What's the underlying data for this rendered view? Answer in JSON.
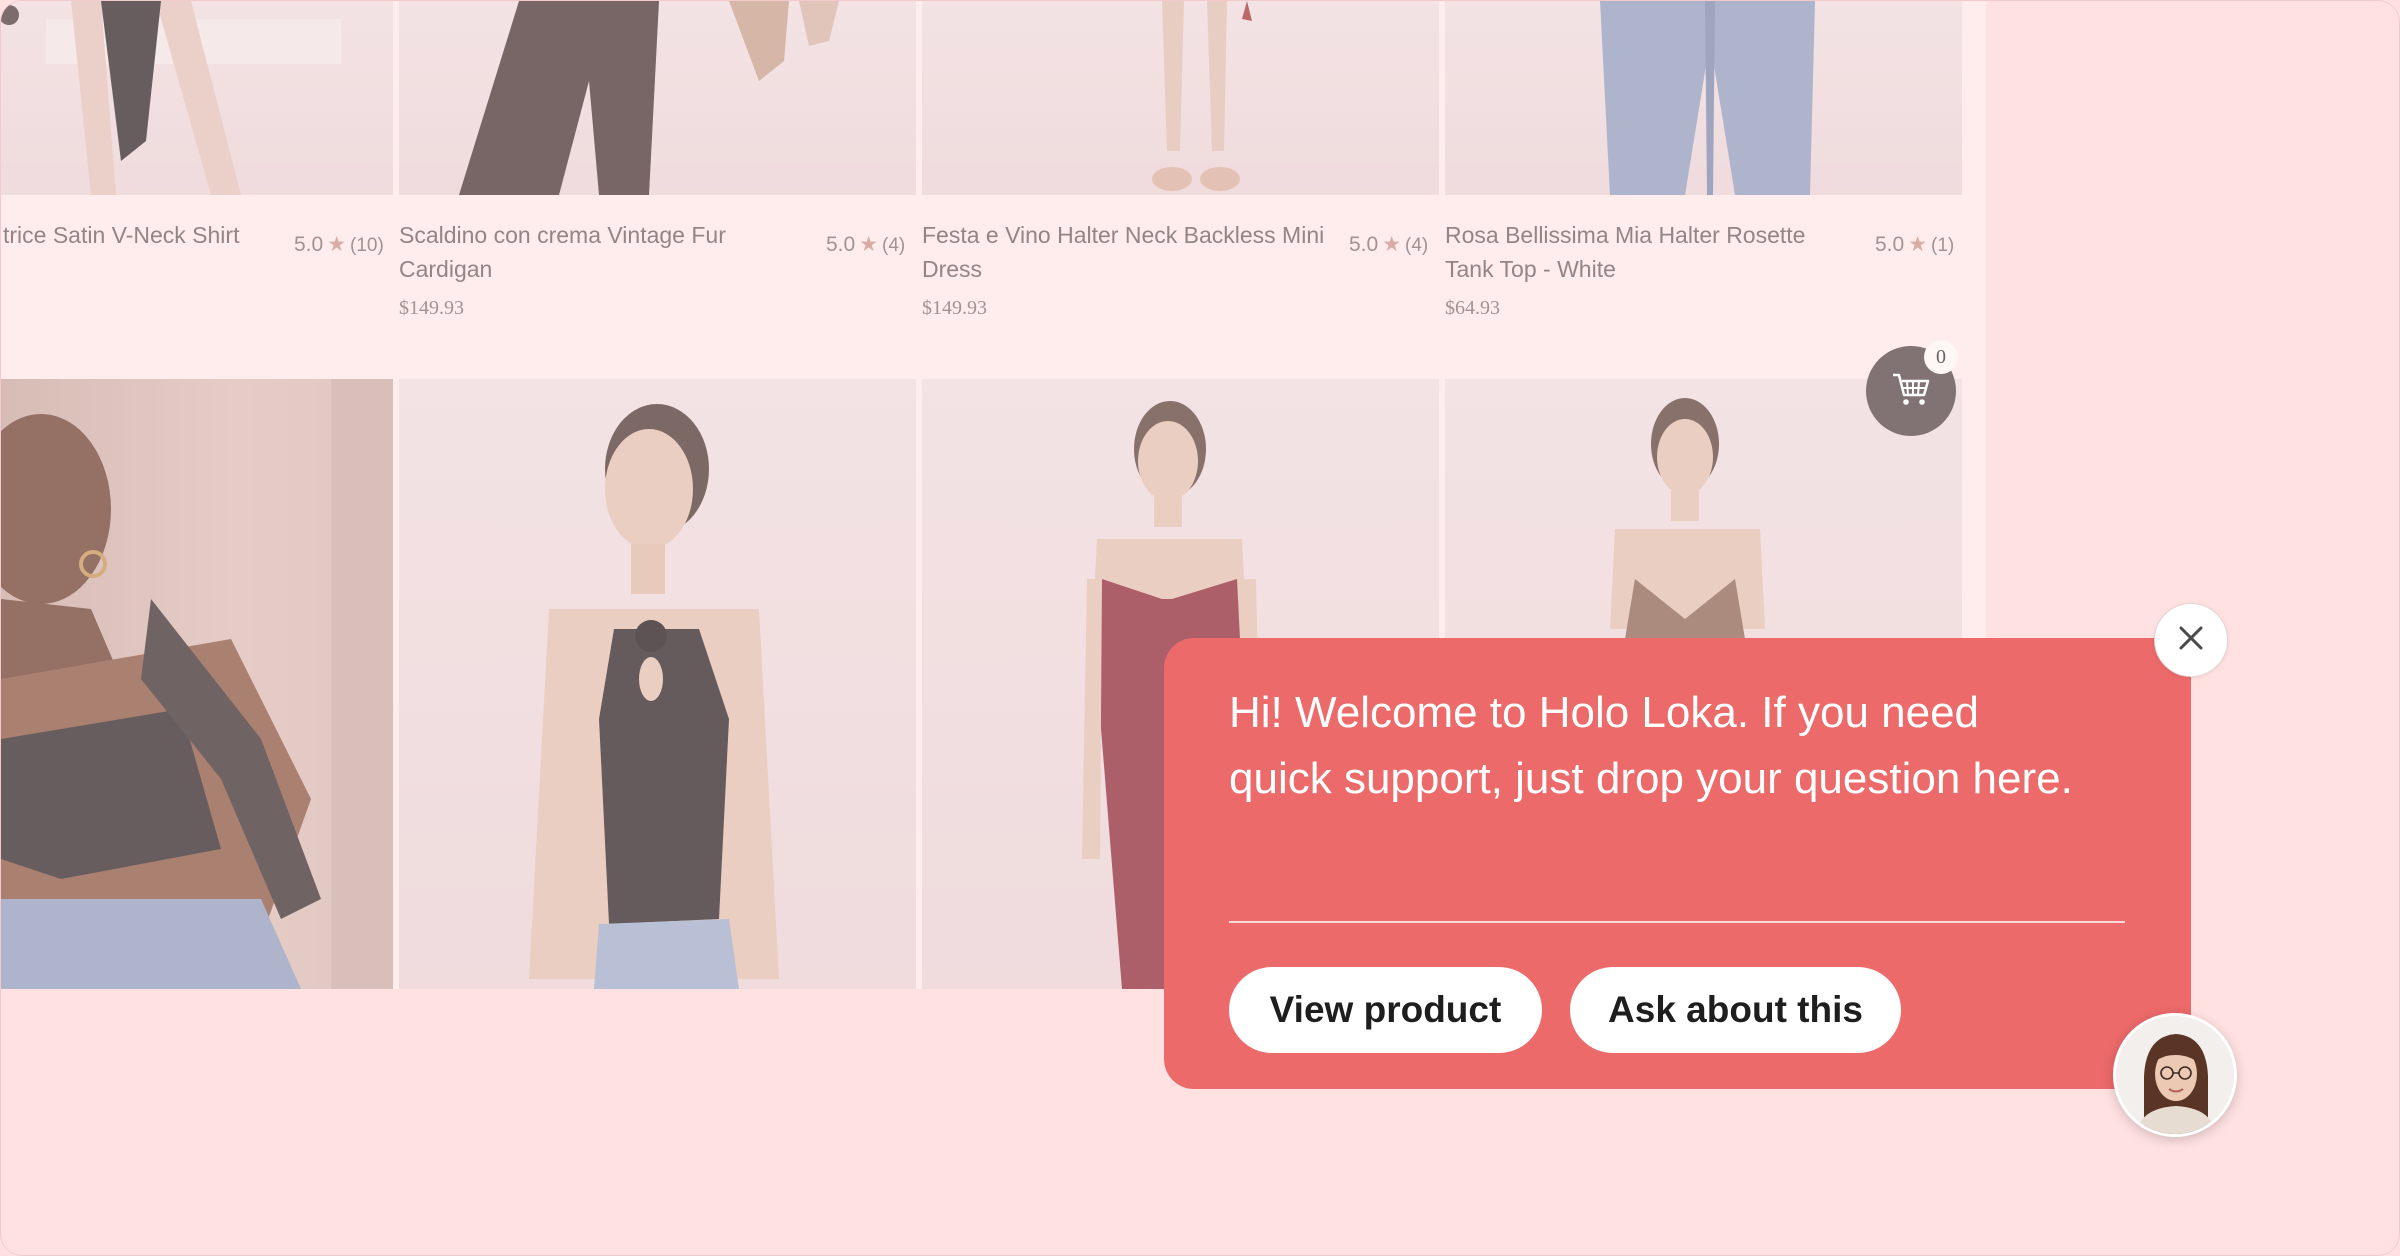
{
  "products_row1": [
    {
      "name": "trice Satin V-Neck Shirt",
      "rating": "5.0",
      "count": "(10)",
      "price": ""
    },
    {
      "name": "Scaldino con crema Vintage Fur Cardigan",
      "rating": "5.0",
      "count": "(4)",
      "price": "$149.93"
    },
    {
      "name": "Festa e Vino Halter Neck Backless Mini Dress",
      "rating": "5.0",
      "count": "(4)",
      "price": "$149.93"
    },
    {
      "name": "Rosa Bellissima Mia Halter Rosette Tank Top - White",
      "rating": "5.0",
      "count": "(1)",
      "price": "$64.93"
    }
  ],
  "star_glyph": "★",
  "cart": {
    "count": "0",
    "icon": "shopping-cart-icon"
  },
  "popup": {
    "message": "Hi! Welcome to Holo Loka. If you need quick support, just drop your question here.",
    "view_product_label": "View product",
    "ask_label": "Ask about this",
    "close_icon": "close-icon",
    "color": "#ec6a6a"
  },
  "agent": {
    "icon": "agent-avatar"
  },
  "colors": {
    "background": "#ffe1e2",
    "accent": "#ec6a6a",
    "cart": "#817373"
  }
}
